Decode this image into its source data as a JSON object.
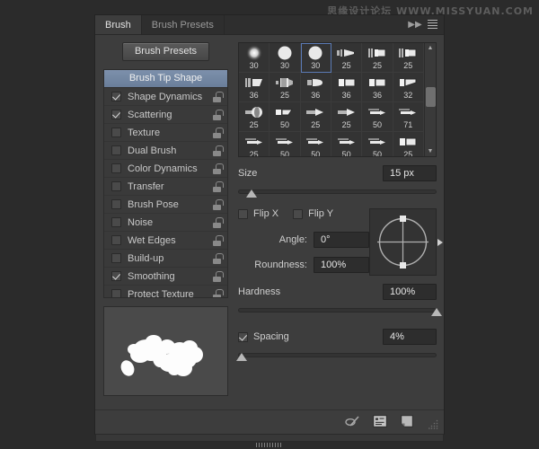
{
  "watermark": "思缘设计论坛  WWW.MISSYUAN.COM",
  "panel": {
    "tabs": [
      {
        "label": "Brush",
        "active": true
      },
      {
        "label": "Brush Presets",
        "active": false
      }
    ],
    "collapse_icon": "double-chevron-right-icon",
    "menu_icon": "panel-menu-icon"
  },
  "sidebar": {
    "presets_button": "Brush Presets",
    "header": "Brush Tip Shape",
    "items": [
      {
        "label": "Shape Dynamics",
        "checked": true,
        "locked": true
      },
      {
        "label": "Scattering",
        "checked": true,
        "locked": true
      },
      {
        "label": "Texture",
        "checked": false,
        "locked": true
      },
      {
        "label": "Dual Brush",
        "checked": false,
        "locked": true
      },
      {
        "label": "Color Dynamics",
        "checked": false,
        "locked": true
      },
      {
        "label": "Transfer",
        "checked": false,
        "locked": true
      },
      {
        "label": "Brush Pose",
        "checked": false,
        "locked": true
      },
      {
        "label": "Noise",
        "checked": false,
        "locked": true
      },
      {
        "label": "Wet Edges",
        "checked": false,
        "locked": true
      },
      {
        "label": "Build-up",
        "checked": false,
        "locked": true
      },
      {
        "label": "Smoothing",
        "checked": true,
        "locked": true
      },
      {
        "label": "Protect Texture",
        "checked": false,
        "locked": true
      }
    ],
    "stroke_preview_name": "brush-stroke-preview"
  },
  "brush_grid": {
    "selected_index": 2,
    "scroll_up_icon": "scroll-up-arrow",
    "scroll_down_icon": "scroll-down-arrow",
    "tips": [
      {
        "size": "30",
        "shape": "soft-round"
      },
      {
        "size": "30",
        "shape": "hard-round"
      },
      {
        "size": "30",
        "shape": "hard-round"
      },
      {
        "size": "25",
        "shape": "flat-angled"
      },
      {
        "size": "25",
        "shape": "flat-block"
      },
      {
        "size": "25",
        "shape": "flat-block"
      },
      {
        "size": "36",
        "shape": "flat-fan"
      },
      {
        "size": "25",
        "shape": "bristle-fan"
      },
      {
        "size": "36",
        "shape": "round-point"
      },
      {
        "size": "36",
        "shape": "square-block"
      },
      {
        "size": "36",
        "shape": "square-block"
      },
      {
        "size": "32",
        "shape": "angled-flat"
      },
      {
        "size": "25",
        "shape": "round-blunt"
      },
      {
        "size": "50",
        "shape": "angled-chisel"
      },
      {
        "size": "25",
        "shape": "arrow-flat"
      },
      {
        "size": "25",
        "shape": "arrow-flat"
      },
      {
        "size": "50",
        "shape": "thin-liner"
      },
      {
        "size": "71",
        "shape": "thin-liner"
      },
      {
        "size": "25",
        "shape": "thin-liner"
      },
      {
        "size": "50",
        "shape": "thin-liner"
      },
      {
        "size": "50",
        "shape": "thin-liner"
      },
      {
        "size": "50",
        "shape": "thin-liner"
      },
      {
        "size": "50",
        "shape": "thin-liner"
      },
      {
        "size": "25",
        "shape": "square-block"
      }
    ]
  },
  "controls": {
    "size": {
      "label": "Size",
      "value": "15 px",
      "slider_percent": 7
    },
    "flip_x": {
      "label": "Flip X",
      "checked": false
    },
    "flip_y": {
      "label": "Flip Y",
      "checked": false
    },
    "angle": {
      "label": "Angle:",
      "value": "0°"
    },
    "roundness": {
      "label": "Roundness:",
      "value": "100%"
    },
    "hardness": {
      "label": "Hardness",
      "value": "100%",
      "slider_percent": 100
    },
    "spacing": {
      "label": "Spacing",
      "value": "4%",
      "checked": true,
      "slider_percent": 2
    },
    "angle_pad_name": "angle-roundness-control"
  },
  "bottom_bar": {
    "icons": [
      {
        "name": "toggle-brush-dynamics-icon"
      },
      {
        "name": "open-preset-manager-icon"
      },
      {
        "name": "new-brush-preset-icon"
      }
    ],
    "resize_grip": "resize-grip"
  },
  "scrollbar": {
    "name": "horizontal-scrollbar"
  }
}
